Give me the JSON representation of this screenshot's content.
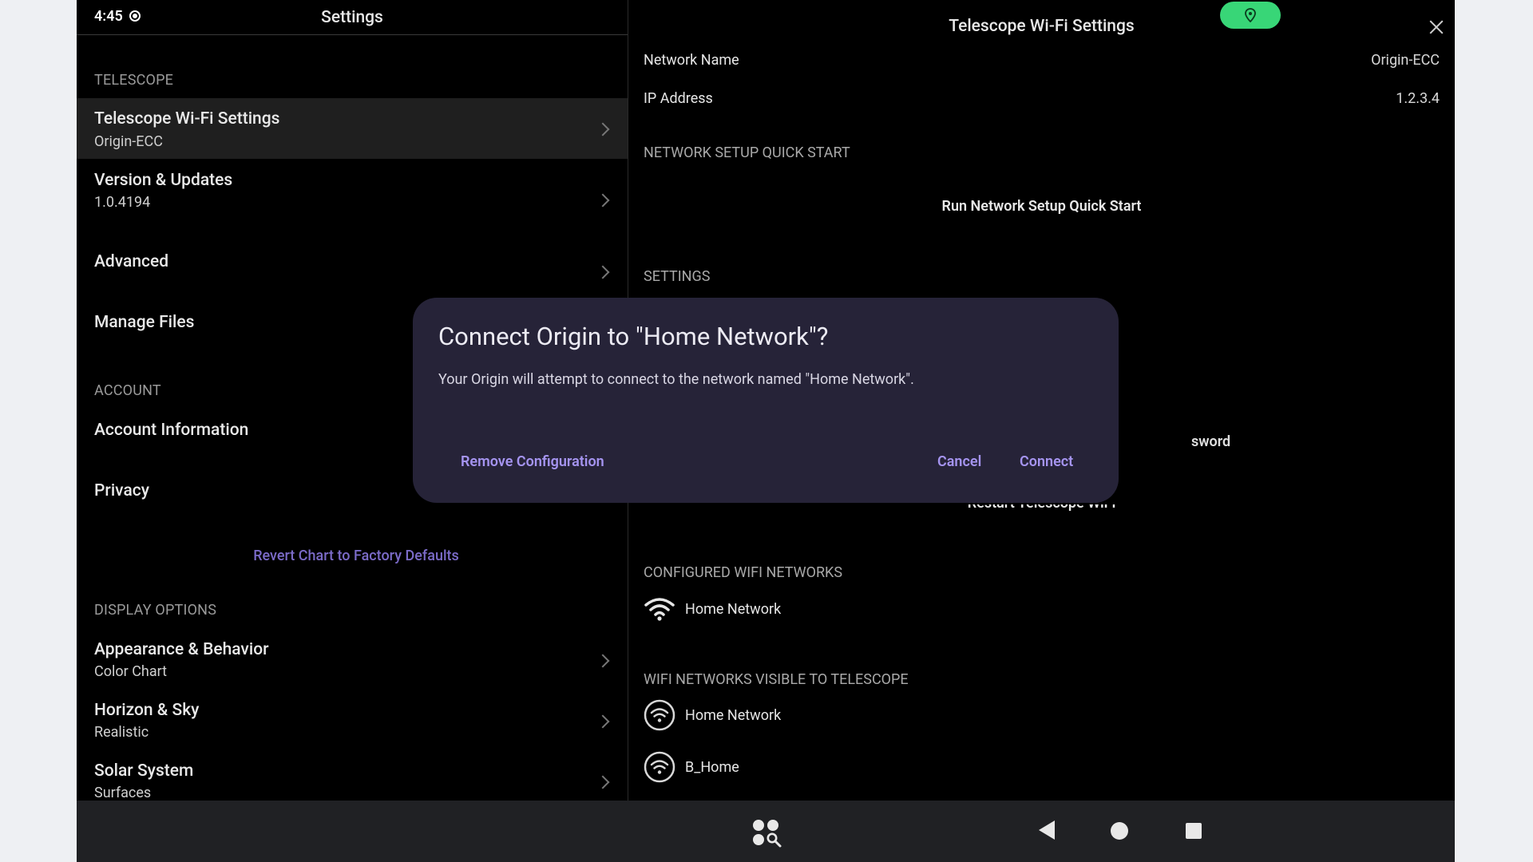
{
  "status_bar": {
    "time": "4:45"
  },
  "left": {
    "title": "Settings",
    "sections": {
      "telescope": "TELESCOPE",
      "account": "ACCOUNT",
      "display": "DISPLAY OPTIONS"
    },
    "items": [
      {
        "title": "Telescope Wi-Fi Settings",
        "subtitle": "Origin-ECC"
      },
      {
        "title": "Version & Updates",
        "subtitle": "1.0.4194"
      },
      {
        "title": "Advanced",
        "subtitle": ""
      },
      {
        "title": "Manage Files",
        "subtitle": ""
      },
      {
        "title": "Account Information",
        "subtitle": ""
      },
      {
        "title": "Privacy",
        "subtitle": ""
      },
      {
        "title": "Appearance & Behavior",
        "subtitle": "Color Chart"
      },
      {
        "title": "Horizon & Sky",
        "subtitle": "Realistic"
      },
      {
        "title": "Solar System",
        "subtitle": "Surfaces"
      }
    ],
    "revert_link": "Revert Chart to Factory Defaults"
  },
  "right": {
    "title": "Telescope Wi-Fi Settings",
    "network_name_label": "Network Name",
    "network_name_value": "Origin-ECC",
    "ip_label": "IP Address",
    "ip_value": "1.2.3.4",
    "quick_start_header": "NETWORK SETUP QUICK START",
    "quick_start_action": "Run Network Setup Quick Start",
    "settings_header": "SETTINGS",
    "toggle1_on": true,
    "toggle2_on": false,
    "partial_password": "sword",
    "restart_wifi": "Restart Telescope WiFi",
    "configured_header": "CONFIGURED WIFI NETWORKS",
    "configured_networks": [
      "Home Network"
    ],
    "visible_header": "WIFI NETWORKS VISIBLE TO TELESCOPE",
    "visible_networks": [
      "Home Network",
      "B_Home"
    ]
  },
  "dialog": {
    "title": "Connect Origin to \"Home Network\"?",
    "body": "Your Origin will attempt to connect to the network named \"Home Network\".",
    "remove_label": "Remove Configuration",
    "cancel_label": "Cancel",
    "connect_label": "Connect"
  },
  "colors": {
    "accent": "#7b6bc8",
    "dialog_button": "#a594f0",
    "toggle_on": "#b55a00",
    "location_pill": "#38d677"
  }
}
